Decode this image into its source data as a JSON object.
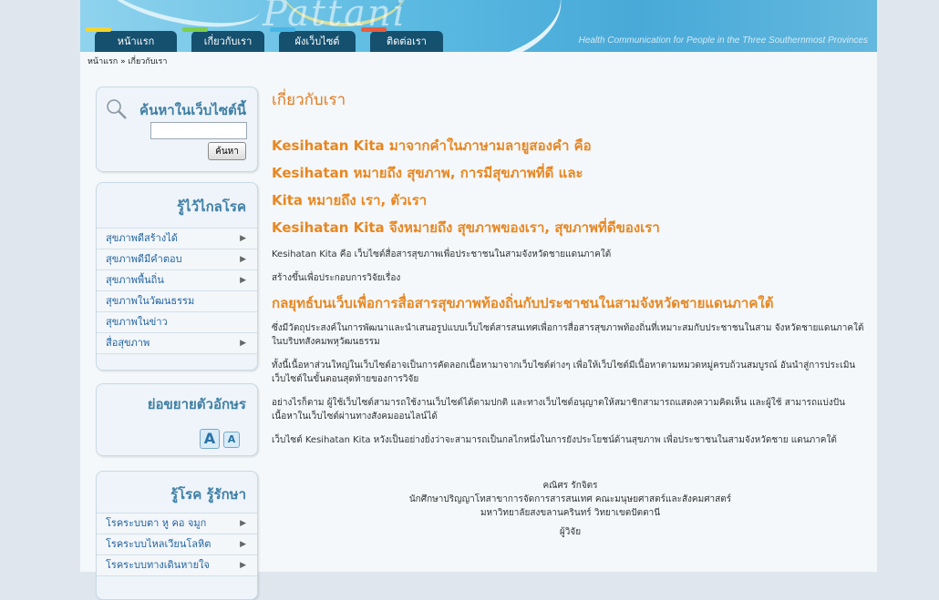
{
  "watermark": "Pattani",
  "header": {
    "tagline": "Health Communication for People in the Three Southernmost Provinces",
    "nav": [
      {
        "label": "หน้าแรก",
        "color": "#f3d431"
      },
      {
        "label": "เกี่ยวกับเรา",
        "color": "#7ccf4a"
      },
      {
        "label": "ผังเว็บไซต์",
        "color": "#47b6e6"
      },
      {
        "label": "ติดต่อเรา",
        "color": "#e85c3e"
      }
    ]
  },
  "breadcrumb": "หน้าแรก » เกี่ยวกับเรา",
  "search": {
    "title": "ค้นหาในเว็บไซต์นี้",
    "placeholder": "",
    "button": "ค้นหา"
  },
  "health_box": {
    "title": "รู้ไว้ไกลโรค",
    "items": [
      {
        "label": "สุขภาพดีสร้างได้",
        "arrow": "▶"
      },
      {
        "label": "สุขภาพดีมีคำตอบ",
        "arrow": "▶"
      },
      {
        "label": "สุขภาพพื้นถิ่น",
        "arrow": "▶"
      },
      {
        "label": "สุขภาพในวัฒนธรรม",
        "arrow": ""
      },
      {
        "label": "สุขภาพในข่าว",
        "arrow": ""
      },
      {
        "label": "สื่อสุขภาพ",
        "arrow": "▶"
      }
    ]
  },
  "font_box": {
    "title": "ย่อขยายตัวอักษร",
    "larger": "A",
    "smaller": "A"
  },
  "disease_box": {
    "title": "รู้โรค รู้รักษา",
    "items": [
      {
        "label": "โรคระบบตา หู คอ จมูก",
        "arrow": "▶"
      },
      {
        "label": "โรคระบบไหลเวียนโลหิต",
        "arrow": "▶"
      },
      {
        "label": "โรคระบบทางเดินหายใจ",
        "arrow": "▶"
      }
    ]
  },
  "content": {
    "title": "เกี่ยวกับเรา",
    "hl1": "Kesihatan Kita มาจากคำในภาษามลายูสองคำ คือ",
    "hl2": "Kesihatan หมายถึง สุขภาพ, การมีสุขภาพที่ดี และ",
    "hl3": "Kita หมายถึง เรา, ตัวเรา",
    "hl4": "Kesihatan Kita จึงหมายถึง สุขภาพของเรา, สุขภาพที่ดีของเรา",
    "p1": "Kesihatan Kita คือ เว็บไซต์สื่อสารสุขภาพเพื่อประชาชนในสามจังหวัดชายแดนภาคใต้",
    "p2": "สร้างขึ้นเพื่อประกอบการวิจัยเรื่อง",
    "hl5": "กลยุทธ์บนเว็บเพื่อการสื่อสารสุขภาพท้องถิ่นกับประชาชนในสามจังหวัดชายแดนภาคใต้",
    "p3": "ซึ่งมีวัตถุประสงค์ในการพัฒนาและนำเสนอรูปแบบเว็บไซต์สารสนเทศเพื่อการสื่อสารสุขภาพท้องถิ่นที่เหมาะสมกับประชาชนในสาม จังหวัดชายแดนภาคใต้ในบริบทสังคมพหุวัฒนธรรม",
    "p4": "ทั้งนี้เนื้อหาส่วนใหญ่ในเว็บไซต์อาจเป็นการคัดลอกเนื้อหามาจากเว็บไซต์ต่างๆ เพื่อให้เว็บไซต์มีเนื้อหาตามหมวดหมู่ครบถ้วนสมบูรณ์ อันนำสู่การประเมินเว็บไซต์ในขั้นตอนสุดท้ายของการวิจัย",
    "p5": "อย่างไรก็ตาม ผู้ใช้เว็บไซต์สามารถใช้งานเว็บไซต์ได้ตามปกติ และทางเว็บไซต์อนุญาตให้สมาชิกสามารถแสดงความคิดเห็น และผู้ใช้ สามารถแบ่งปันเนื้อหาในเว็บไซต์ผ่านทางสังคมออนไลน์ได้",
    "p6": "เว็บไซต์ Kesihatan Kita หวังเป็นอย่างยิ่งว่าจะสามารถเป็นกลไกหนึ่งในการยังประโยชน์ด้านสุขภาพ เพื่อประชาชนในสามจังหวัดชาย แดนภาคใต้",
    "sig_name": "คณิศร รักจิตร",
    "sig_line1": "นักศึกษาปริญญาโทสาขาการจัดการสารสนเทศ คณะมนุษยศาสตร์และสังคมศาสตร์",
    "sig_line2": "มหาวิทยาลัยสงขลานครินทร์ วิทยาเขตปัตตานี",
    "sig_role": "ผู้วิจัย"
  }
}
